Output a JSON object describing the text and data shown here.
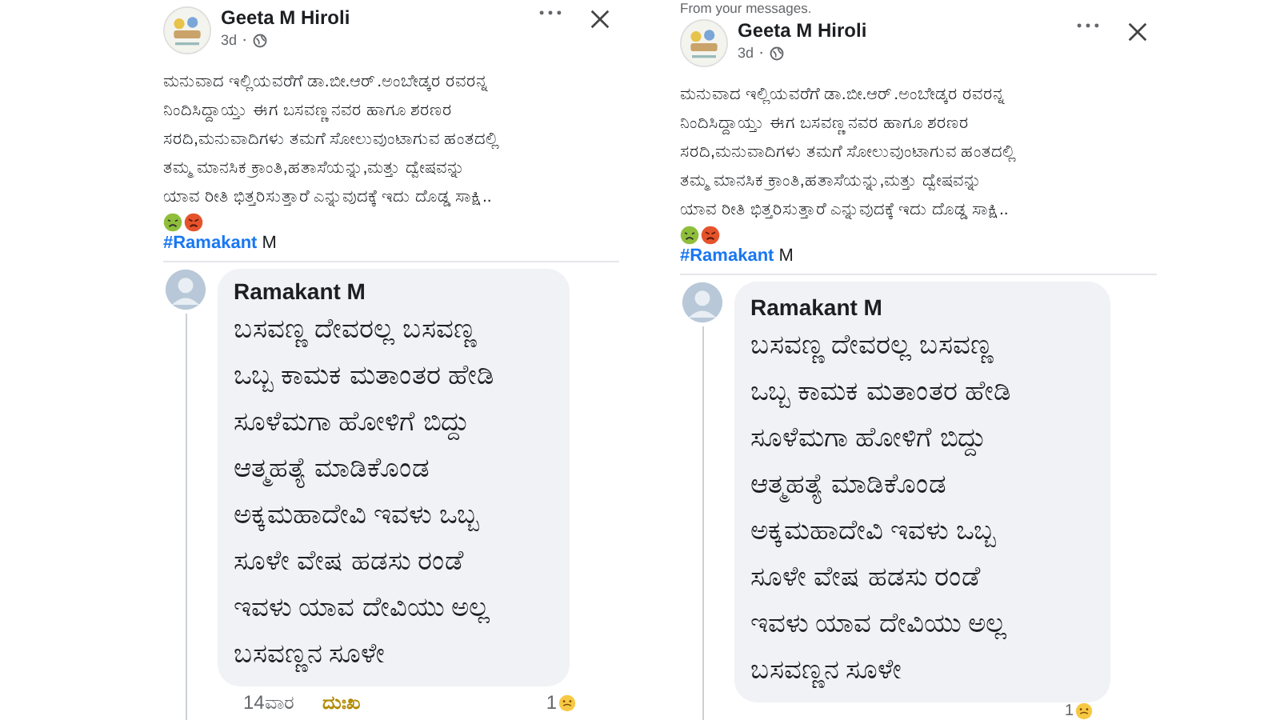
{
  "panels": [
    {
      "post": {
        "author": "Geeta M Hiroli",
        "time": "3d",
        "separator": "·",
        "text": "ಮನುವಾದ ಇಲ್ಲಿಯವರೆಗೆ ಡಾ.ಬೀ.ಆರ್.ಅಂಬೇಡ್ಕರ ರವರನ್ನ\nನಿಂದಿಸಿದ್ದಾಯ್ತು ಈಗ ಬಸವಣ್ಣನವರ ಹಾಗೂ ಶರಣರ\nಸರದಿ,ಮನುವಾದಿಗಳು ತಮಗೆ ಸೋಲುವುಂಟಾಗುವ ಹಂತದಲ್ಲಿ\nತಮ್ಮ ಮಾನಸಿಕ ಕ್ರಾಂತಿ,ಹತಾಸೆಯನ್ನು,ಮತ್ತು ದ್ವೇಷವನ್ನು\nಯಾವ ರೀತಿ ಭಿತ್ತರಿಸುತ್ತಾರೆ ಎನ್ನುವುದಕ್ಕೆ ಇದು ದೊಡ್ಡ ಸಾಕ್ಷಿ..",
        "hashtag": "#Ramakant",
        "tag_rest": "M"
      },
      "comment": {
        "author": "Ramakant M",
        "text": "ಬಸವಣ್ಣ ದೇವರಲ್ಲ ಬಸವಣ್ಣ\nಒಬ್ಬ ಕಾಮಕ ಮತಾಂತರ ಹೇಡಿ\nಸೂಳೆಮಗಾ ಹೋಳಿಗೆ ಬಿದ್ದು\nಆತ್ಮಹತ್ಯೆ ಮಾಡಿಕೊಂಡ\nಅಕ್ಕಮಹಾದೇವಿ ಇವಳು ಒಬ್ಬ\nಸೂಳೇ ವೇಷ ಹಡಸು ರಂಡೆ\nಇವಳು ಯಾವ ದೇವಿಯು ಅಲ್ಲ\nಬಸವಣ್ಣನ ಸೂಳೇ",
        "time": "14ವಾರ",
        "action": "ದುಃಖ",
        "reaction_count": "1"
      }
    },
    {
      "note": "From your messages.",
      "post": {
        "author": "Geeta M Hiroli",
        "time": "3d",
        "separator": "·",
        "text": "ಮನುವಾದ ಇಲ್ಲಿಯವರೆಗೆ ಡಾ.ಬೀ.ಆರ್.ಅಂಬೇಡ್ಕರ ರವರನ್ನ\nನಿಂದಿಸಿದ್ದಾಯ್ತು ಈಗ ಬಸವಣ್ಣನವರ ಹಾಗೂ ಶರಣರ\nಸರದಿ,ಮನುವಾದಿಗಳು ತಮಗೆ ಸೋಲುವುಂಟಾಗುವ ಹಂತದಲ್ಲಿ\nತಮ್ಮ ಮಾನಸಿಕ ಕ್ರಾಂತಿ,ಹತಾಸೆಯನ್ನು,ಮತ್ತು ದ್ವೇಷವನ್ನು\nಯಾವ ರೀತಿ ಭಿತ್ತರಿಸುತ್ತಾರೆ ಎನ್ನುವುದಕ್ಕೆ ಇದು ದೊಡ್ಡ ಸಾಕ್ಷಿ..",
        "hashtag": "#Ramakant",
        "tag_rest": "M"
      },
      "comment": {
        "author": "Ramakant M",
        "text": "ಬಸವಣ್ಣ ದೇವರಲ್ಲ ಬಸವಣ್ಣ\nಒಬ್ಬ ಕಾಮಕ ಮತಾಂತರ ಹೇಡಿ\nಸೂಳೆಮಗಾ ಹೋಳಿಗೆ ಬಿದ್ದು\nಆತ್ಮಹತ್ಯೆ ಮಾಡಿಕೊಂಡ\nಅಕ್ಕಮಹಾದೇವಿ ಇವಳು ಒಬ್ಬ\nಸೂಳೇ ವೇಷ ಹಡಸು ರಂಡೆ\nಇವಳು ಯಾವ ದೇವಿಯು ಅಲ್ಲ\nಬಸವಣ್ಣನ ಸೂಳೇ",
        "reaction_count": "1"
      }
    }
  ]
}
